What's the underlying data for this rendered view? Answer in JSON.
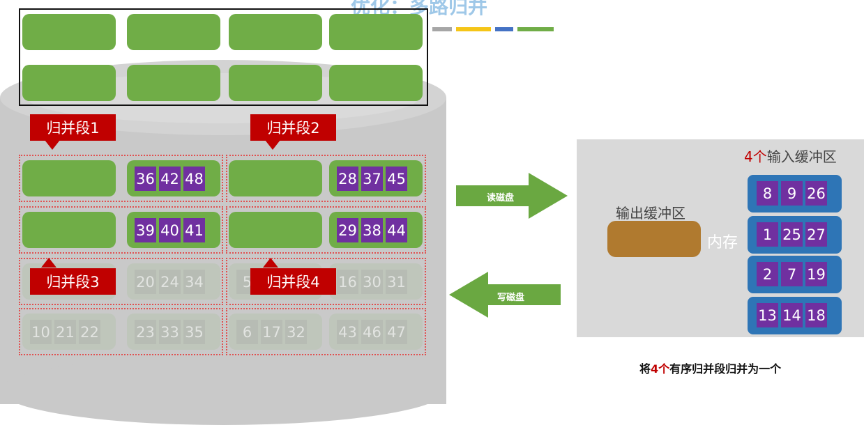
{
  "title": "优化：多路归并",
  "colors": {
    "segment_label": "#c00000",
    "block": "#70ad47",
    "record": "#7030a0",
    "input_buffer": "#2e75b6",
    "output_buffer": "#b07a2f",
    "arrow": "#6aa841"
  },
  "disk": {
    "segments": [
      {
        "label": "归并段1",
        "row1": [
          "36",
          "42",
          "48"
        ],
        "row2": [
          "39",
          "40",
          "41"
        ]
      },
      {
        "label": "归并段2",
        "row1": [
          "28",
          "37",
          "45"
        ],
        "row2": [
          "29",
          "38",
          "44"
        ]
      },
      {
        "label": "归并段3"
      },
      {
        "label": "归并段4"
      }
    ],
    "faded_row1": [
      [
        "20",
        "24",
        "34"
      ],
      [
        "5"
      ],
      [
        "16",
        "30",
        "31"
      ]
    ],
    "faded_row2": [
      [
        "10",
        "21",
        "22"
      ],
      [
        "23",
        "33",
        "35"
      ],
      [
        "6",
        "17",
        "32"
      ],
      [
        "43",
        "46",
        "47"
      ]
    ]
  },
  "arrows": {
    "read": "读磁盘",
    "write": "写磁盘"
  },
  "memory": {
    "input_label_count": "4个",
    "input_label_text": "输入缓冲区",
    "output_label": "输出缓冲区",
    "memory_label": "内存",
    "input_buffers": [
      [
        "8",
        "9",
        "26"
      ],
      [
        "1",
        "25",
        "27"
      ],
      [
        "2",
        "7",
        "19"
      ],
      [
        "13",
        "14",
        "18"
      ]
    ]
  },
  "caption": {
    "prefix": "将",
    "count": "4个",
    "suffix": "有序归并段归并为一个"
  }
}
